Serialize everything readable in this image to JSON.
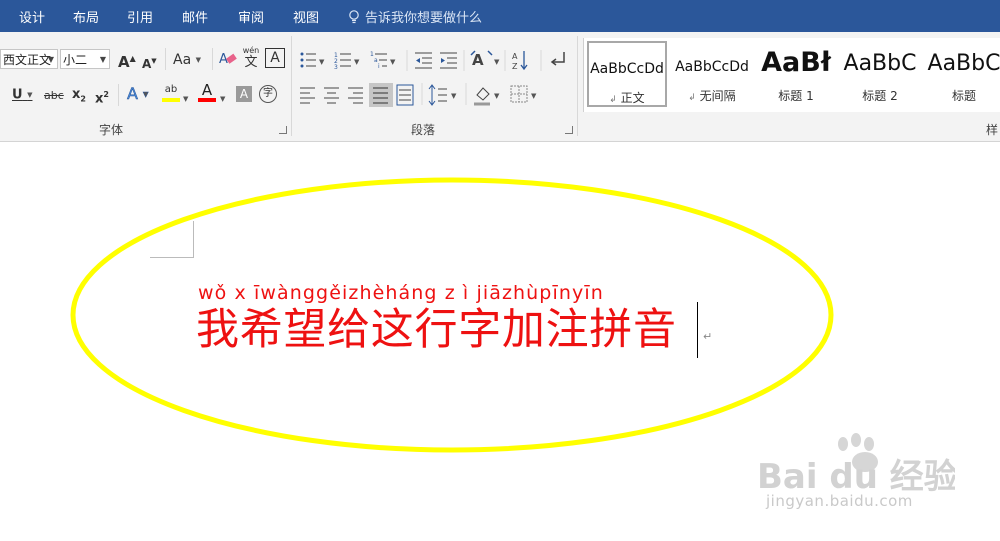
{
  "tabs": [
    "设计",
    "布局",
    "引用",
    "邮件",
    "审阅",
    "视图"
  ],
  "tell_me": "告诉我你想要做什么",
  "font_group": {
    "font_name": "西文正文",
    "font_size": "小二",
    "label": "字体",
    "grow_font": "A",
    "shrink_font": "A",
    "change_case": "Aa",
    "phonetic_guide_top": "wén",
    "phonetic_guide_bottom": "文",
    "char_border": "A",
    "underline": "U",
    "strikethrough": "abc",
    "subscript_base": "x",
    "subscript_mark": "2",
    "superscript_base": "x",
    "superscript_mark": "2",
    "text_effects": "A",
    "highlight": "ab",
    "font_color": "A",
    "char_shading": "A",
    "enclose": "字"
  },
  "paragraph_group": {
    "label": "段落"
  },
  "styles": {
    "items": [
      {
        "sample": "AaBbCcDd",
        "name": "正文",
        "selected": true
      },
      {
        "sample": "AaBbCcDd",
        "name": "无间隔",
        "selected": false
      },
      {
        "sample": "AaBł",
        "name": "标题 1",
        "selected": false
      },
      {
        "sample": "AaBbC",
        "name": "标题 2",
        "selected": false
      },
      {
        "sample": "AaBbC",
        "name": "标题",
        "selected": false
      }
    ],
    "label": "样"
  },
  "document": {
    "pinyin": "wǒ x īwànggěizhèháng z ì jiāzhùpīnyīn",
    "text": "我希望给这行字加注拼音",
    "paragraph_mark": "↵"
  },
  "watermark": {
    "brand": "Bai du 经验",
    "url": "jingyan.baidu.com"
  },
  "colors": {
    "tab_bar": "#2b579a",
    "ribbon": "#f3f3f3",
    "text_red": "#ee1111",
    "highlight_ellipse": "#ffff00",
    "font_color_bar": "#ff0000",
    "highlight_bar": "#ffff00"
  }
}
